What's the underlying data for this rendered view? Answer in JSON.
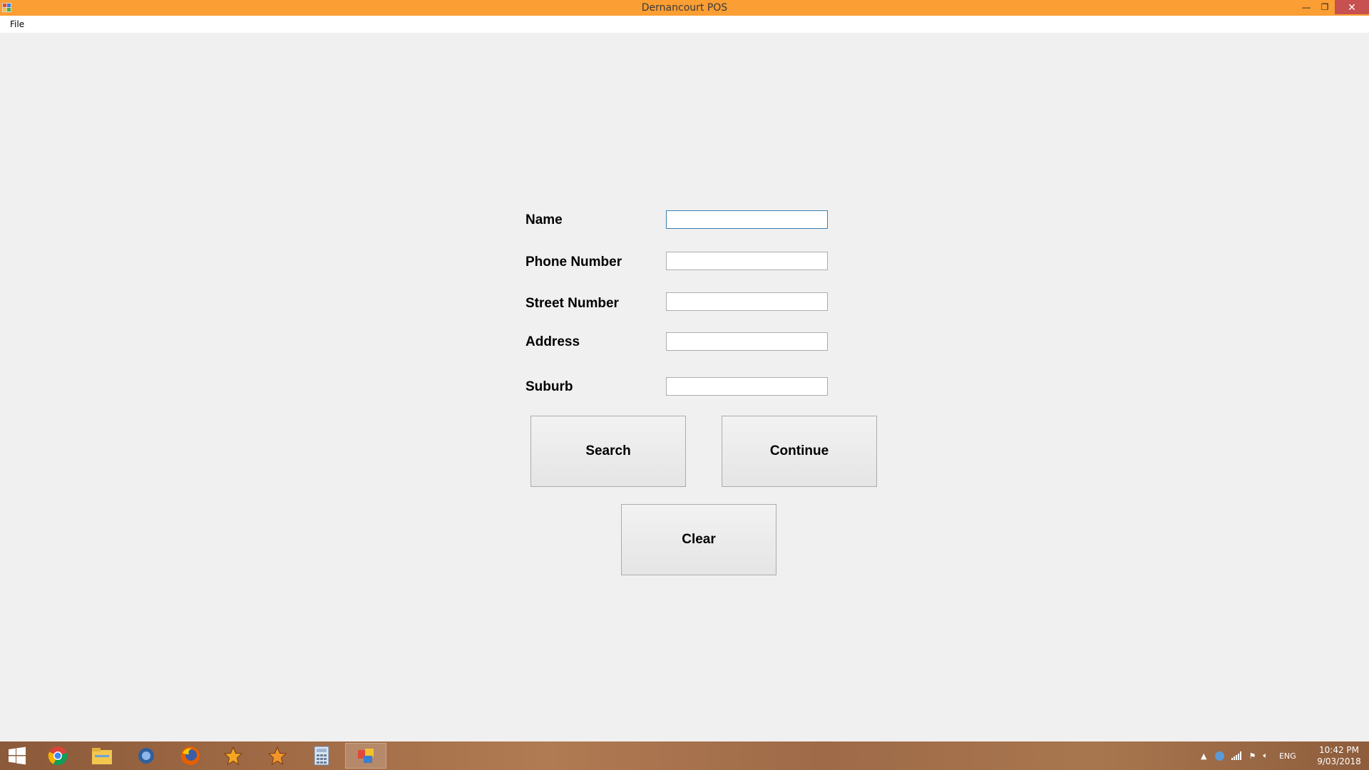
{
  "window": {
    "title": "Dernancourt POS",
    "minimize_glyph": "—",
    "maximize_glyph": "❐",
    "close_glyph": "✕"
  },
  "menu": {
    "file_label": "File"
  },
  "form": {
    "name_label": "Name",
    "phone_label": "Phone Number",
    "street_number_label": "Street Number",
    "address_label": "Address",
    "suburb_label": "Suburb",
    "name_value": "",
    "phone_value": "",
    "street_number_value": "",
    "address_value": "",
    "suburb_value": ""
  },
  "buttons": {
    "search_label": "Search",
    "continue_label": "Continue",
    "clear_label": "Clear"
  },
  "taskbar": {
    "items": [
      "windows-start-icon",
      "chrome-icon",
      "file-explorer-icon",
      "app-icon",
      "firefox-icon",
      "star-app-icon",
      "star-app-icon",
      "calculator-icon",
      "pos-app-icon"
    ],
    "language": "ENG",
    "time": "10:42 PM",
    "date": "9/03/2018"
  },
  "colors": {
    "titlebar": "#fb9e33",
    "close_button": "#c75050"
  }
}
